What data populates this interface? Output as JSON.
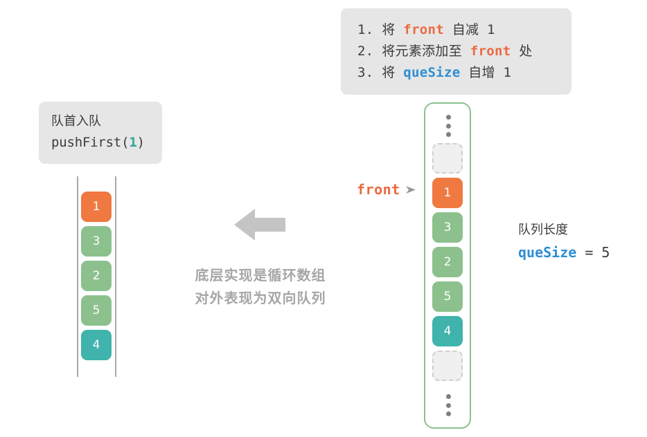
{
  "steps_box": {
    "lines": [
      {
        "prefix": "1. 将 ",
        "code": "front",
        "code_color": "orange",
        "suffix": " 自减 1"
      },
      {
        "prefix": "2. 将元素添加至 ",
        "code": "front",
        "code_color": "orange",
        "suffix": " 处"
      },
      {
        "prefix": "3. 将 ",
        "code": "queSize",
        "code_color": "blue",
        "suffix": " 自增 1"
      }
    ]
  },
  "op_box": {
    "title": "队首入队",
    "call_prefix": "pushFirst(",
    "call_arg": "1",
    "call_suffix": ")"
  },
  "left_column": {
    "cells": [
      {
        "value": "1",
        "color": "orange"
      },
      {
        "value": "3",
        "color": "green"
      },
      {
        "value": "2",
        "color": "green"
      },
      {
        "value": "5",
        "color": "green"
      },
      {
        "value": "4",
        "color": "teal"
      }
    ]
  },
  "center": {
    "arrow_icon": "arrow-left-icon",
    "caption_line1": "底层实现是循环数组",
    "caption_line2": "对外表现为双向队列"
  },
  "right_column": {
    "top_ellipsis": "⋮",
    "bottom_ellipsis": "⋮",
    "cells": [
      {
        "value": "",
        "color": "empty"
      },
      {
        "value": "1",
        "color": "orange"
      },
      {
        "value": "3",
        "color": "green"
      },
      {
        "value": "2",
        "color": "green"
      },
      {
        "value": "5",
        "color": "green"
      },
      {
        "value": "4",
        "color": "teal"
      },
      {
        "value": "",
        "color": "empty"
      }
    ]
  },
  "front_pointer": {
    "label": "front",
    "arrow_icon": "arrow-right-small-icon"
  },
  "size_annotation": {
    "title": "队列长度",
    "var_name": "queSize",
    "equals": " = ",
    "value": "5"
  },
  "colors": {
    "orange": "#ef7941",
    "green": "#8cc18d",
    "teal": "#3fb3ac",
    "blue": "#2e8ed4",
    "box_bg": "#e6e6e6",
    "gray_text": "#a6a6a6",
    "rail": "#a8a8a8",
    "empty_fill": "#f0f0f0",
    "empty_border": "#cfcfcf"
  }
}
